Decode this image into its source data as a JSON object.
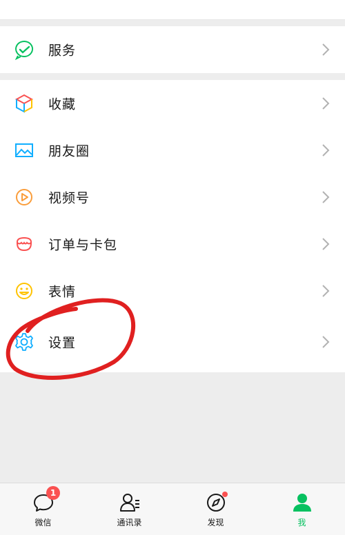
{
  "menu": {
    "items": [
      {
        "label": "服务",
        "icon": "service-icon"
      },
      {
        "label": "收藏",
        "icon": "favorites-cube-icon"
      },
      {
        "label": "朋友圈",
        "icon": "moments-image-icon"
      },
      {
        "label": "视频号",
        "icon": "channels-play-icon"
      },
      {
        "label": "订单与卡包",
        "icon": "orders-cards-icon"
      },
      {
        "label": "表情",
        "icon": "sticker-smiley-icon"
      },
      {
        "label": "设置",
        "icon": "settings-gear-icon"
      }
    ]
  },
  "tabbar": {
    "tabs": [
      {
        "label": "微信",
        "icon": "chat-bubble-icon",
        "badge": "1"
      },
      {
        "label": "通讯录",
        "icon": "contacts-icon"
      },
      {
        "label": "发现",
        "icon": "discover-compass-icon"
      },
      {
        "label": "我",
        "icon": "me-person-icon",
        "active": true
      }
    ]
  },
  "colors": {
    "accent": "#07c160",
    "badge": "#fa5151",
    "annotation": "#e02020",
    "background": "#ededed"
  }
}
